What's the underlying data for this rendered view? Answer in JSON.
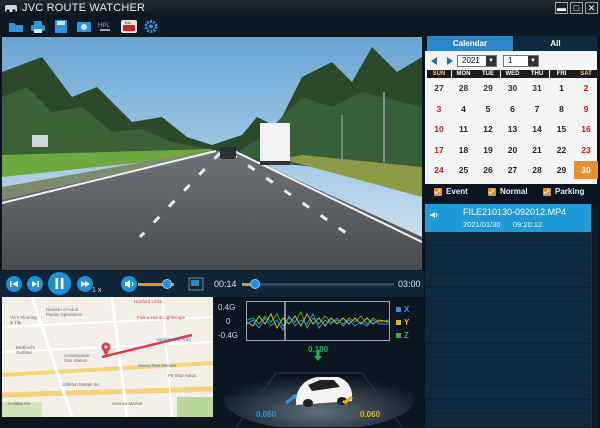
{
  "window": {
    "title": "JVC ROUTE WATCHER",
    "btn_minimize": "▬",
    "btn_maximize": "□",
    "btn_close": "✕"
  },
  "toolbar": {
    "items": [
      "open-folder",
      "print",
      "save",
      "snapshot",
      "hpl",
      "youtube",
      "settings"
    ]
  },
  "playback": {
    "speed": "1 x",
    "current_time": "00:14",
    "total_time": "03:00",
    "progress": 0.05,
    "volume": 0.7
  },
  "gsensor": {
    "labels": [
      "0.4G",
      "0",
      "-0.4G"
    ],
    "axes": [
      {
        "name": "X",
        "color": "#2f8fe6"
      },
      {
        "name": "Y",
        "color": "#e8b21c"
      },
      {
        "name": "Z",
        "color": "#28b14c"
      }
    ]
  },
  "car_view": {
    "top_value": "0.180",
    "left_value": "0.060",
    "right_value": "0.060"
  },
  "map": {
    "labels": [
      "Division of Adult Parole Operations",
      "Hartford Links",
      "Vic's Flooring & Tile",
      "Fixit-a-Hat & Lightscape",
      "Vandermeer Auto",
      "Centerpointe Gas Station",
      "Bedford's Outfitter",
      "Littleton Metals Inc",
      "Sierra Tree Service",
      "Holiday Inn",
      "Pit Stop Autos",
      "Sunrise Market"
    ]
  },
  "calendar": {
    "tabs": [
      "Calendar",
      "All"
    ],
    "year": "2021",
    "month": "1",
    "weekdays": [
      "SUN",
      "MON",
      "TUE",
      "WED",
      "THU",
      "FRI",
      "SAT"
    ],
    "weeks": [
      [
        "27",
        "28",
        "29",
        "30",
        "31",
        "1",
        "2"
      ],
      [
        "3",
        "4",
        "5",
        "6",
        "7",
        "8",
        "9"
      ],
      [
        "10",
        "11",
        "12",
        "13",
        "14",
        "15",
        "16"
      ],
      [
        "17",
        "18",
        "19",
        "20",
        "21",
        "22",
        "23"
      ],
      [
        "24",
        "25",
        "26",
        "27",
        "28",
        "29",
        "30"
      ]
    ],
    "selected_day": "30",
    "accent": "#e8902a",
    "filters": [
      "Event",
      "Normal",
      "Parking"
    ]
  },
  "files": [
    {
      "name": "FILE210130-092012.MP4",
      "date": "2021/01/30",
      "time": "09:20:12"
    }
  ]
}
